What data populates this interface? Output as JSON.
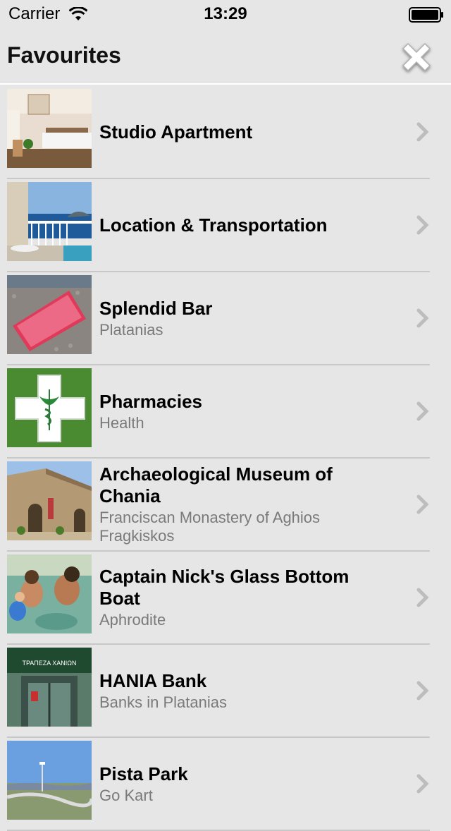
{
  "status_bar": {
    "carrier": "Carrier",
    "time": "13:29"
  },
  "nav": {
    "title": "Favourites",
    "close_icon": "close-x-icon"
  },
  "favourites": [
    {
      "title": "Studio Apartment",
      "subtitle": "",
      "thumb": "studio-apartment-photo"
    },
    {
      "title": "Location & Transportation",
      "subtitle": "",
      "thumb": "sea-view-balcony-photo"
    },
    {
      "title": "Splendid Bar",
      "subtitle": "Platanias",
      "thumb": "splendid-bar-card-photo"
    },
    {
      "title": "Pharmacies",
      "subtitle": "Health",
      "thumb": "pharmacy-cross-icon"
    },
    {
      "title": "Archaeological Museum of Chania",
      "subtitle": "Franciscan Monastery of Aghios Fragkiskos",
      "thumb": "museum-building-photo"
    },
    {
      "title": "Captain Nick's Glass Bottom Boat",
      "subtitle": "Aphrodite",
      "thumb": "swimmers-photo"
    },
    {
      "title": "HANIA Bank",
      "subtitle": "Banks in Platanias",
      "thumb": "bank-entrance-photo",
      "thumb_sign": "ΤΡΑΠΕΖΑ ΧΑΝΙΩΝ"
    },
    {
      "title": "Pista Park",
      "subtitle": "Go Kart",
      "thumb": "go-kart-track-photo"
    }
  ],
  "colors": {
    "background": "#e6e6e6",
    "separator": "#c8c8c8",
    "subtitle": "#7a7a7a",
    "chevron": "#bdbdbd"
  }
}
